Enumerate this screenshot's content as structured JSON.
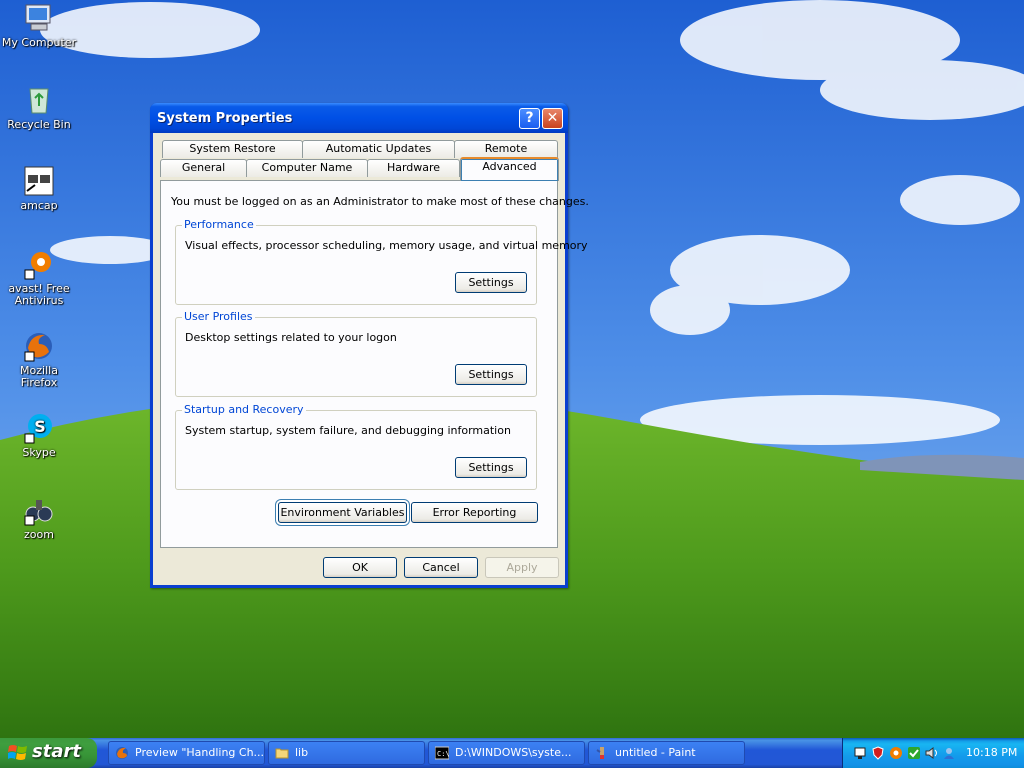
{
  "desktop_icons": [
    {
      "label": "My Computer",
      "icon": "my-computer-icon"
    },
    {
      "label": "Recycle Bin",
      "icon": "recycle-bin-icon"
    },
    {
      "label": "amcap",
      "icon": "amcap-icon"
    },
    {
      "label": "avast! Free Antivirus",
      "icon": "avast-icon"
    },
    {
      "label": "Mozilla Firefox",
      "icon": "firefox-icon"
    },
    {
      "label": "Skype",
      "icon": "skype-icon"
    },
    {
      "label": "zoom",
      "icon": "zoom-icon"
    }
  ],
  "window": {
    "title": "System Properties",
    "help_glyph": "?",
    "close_glyph": "✕",
    "tabs_row1": [
      "System Restore",
      "Automatic Updates",
      "Remote"
    ],
    "tabs_row2": [
      "General",
      "Computer Name",
      "Hardware",
      "Advanced"
    ],
    "selected_tab": "Advanced",
    "admin_note": "You must be logged on as an Administrator to make most of these changes.",
    "groups": [
      {
        "title": "Performance",
        "desc": "Visual effects, processor scheduling, memory usage, and virtual memory",
        "button": "Settings"
      },
      {
        "title": "User Profiles",
        "desc": "Desktop settings related to your logon",
        "button": "Settings"
      },
      {
        "title": "Startup and Recovery",
        "desc": "System startup, system failure, and debugging information",
        "button": "Settings"
      }
    ],
    "env_button": "Environment Variables",
    "error_button": "Error Reporting",
    "ok": "OK",
    "cancel": "Cancel",
    "apply": "Apply"
  },
  "taskbar": {
    "start": "start",
    "tasks": [
      {
        "label": "Preview \"Handling Ch...",
        "icon": "firefox-icon"
      },
      {
        "label": "lib",
        "icon": "folder-icon"
      },
      {
        "label": "D:\\WINDOWS\\syste...",
        "icon": "cmd-icon"
      },
      {
        "label": "untitled - Paint",
        "icon": "paint-icon"
      }
    ],
    "clock": "10:18 PM"
  },
  "colors": {
    "sky": "#2f6fd8",
    "grass": "#4a9a1e",
    "titlebar": "#0050e6",
    "accent": "#0046d5"
  }
}
